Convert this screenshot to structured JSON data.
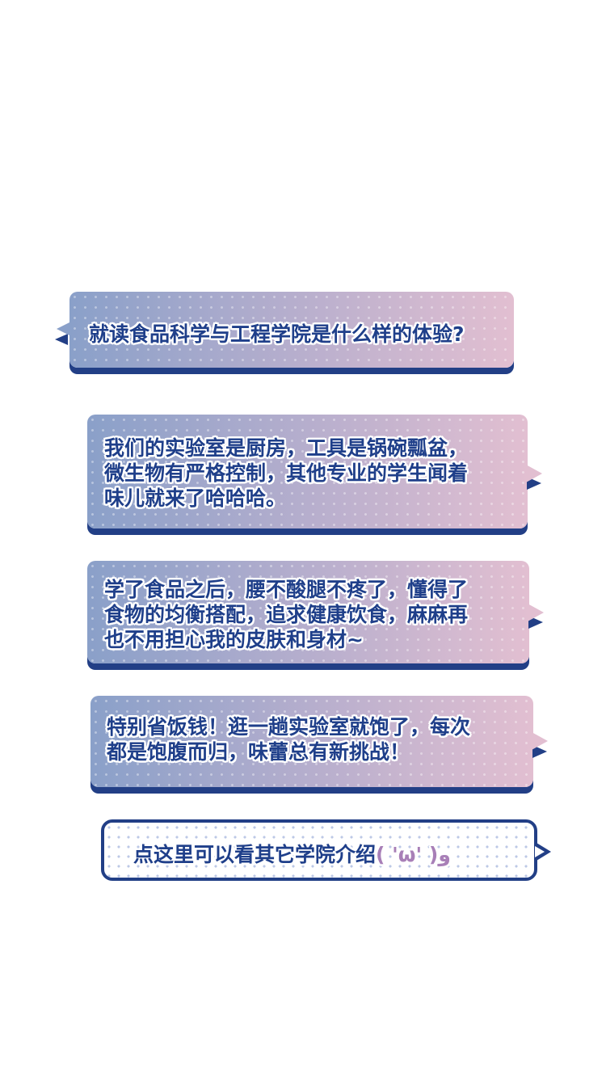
{
  "question": "就读食品科学与工程学院是什么样的体验?",
  "answers": [
    {
      "lines": [
        "我们的实验室是厨房，工具是锅碗瓢盆，",
        "微生物有严格控制，其他专业的学生闻着",
        "味儿就来了哈哈哈。"
      ]
    },
    {
      "lines": [
        "学了食品之后，腰不酸腿不疼了，懂得了",
        "食物的均衡搭配，追求健康饮食，麻麻再",
        "也不用担心我的皮肤和身材~"
      ]
    },
    {
      "lines": [
        "特别省饭钱！逛一趟实验室就饱了，每次",
        "都是饱腹而归，味蕾总有新挑战！"
      ]
    }
  ],
  "link_button": {
    "label": "点这里可以看其它学院介绍",
    "emoticon": "( 'ω' )و"
  },
  "colors": {
    "text_dark_blue": "#1f3f8a",
    "shadow_navy": "#223f86",
    "gradient_start": "#8aa0c9",
    "gradient_end": "#e2bfd1",
    "emoticon": "#a87fb7"
  }
}
